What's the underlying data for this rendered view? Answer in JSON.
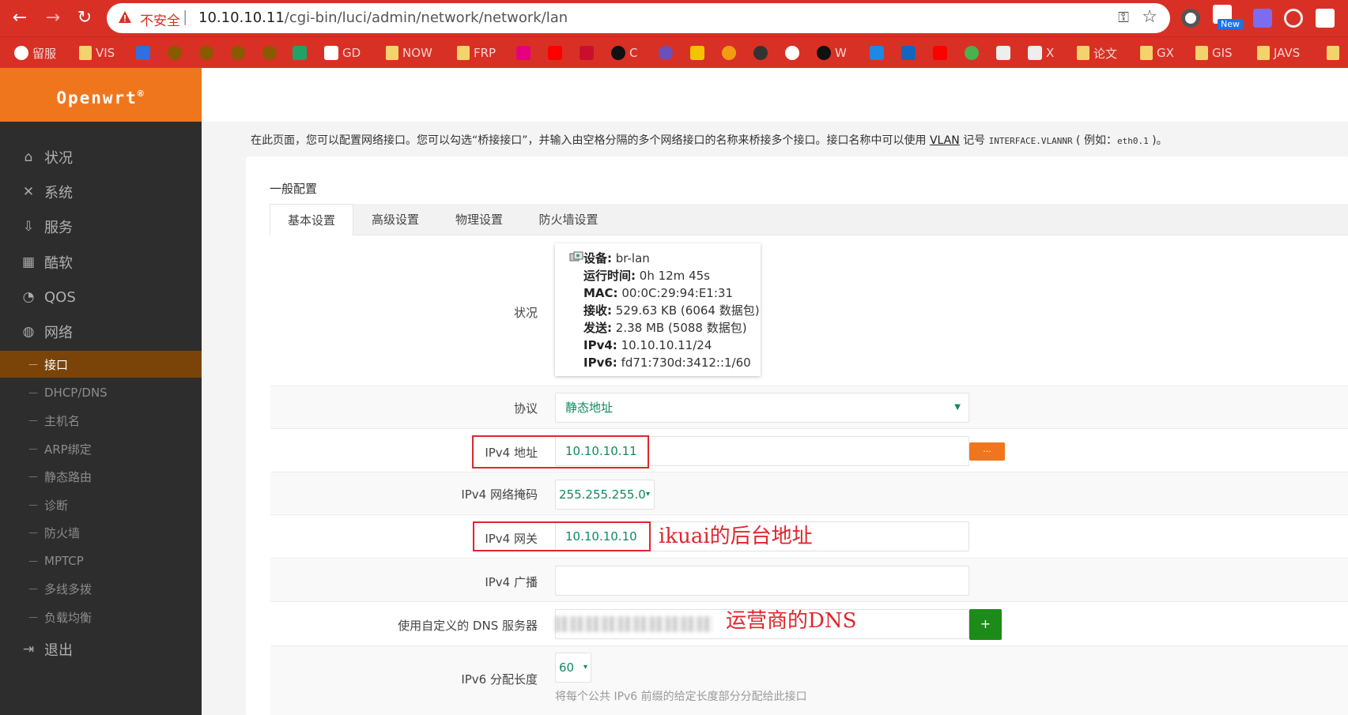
{
  "browser": {
    "insecure_label": "不安全",
    "url_host": "10.10.10.11",
    "url_path": "/cgi-bin/luci/admin/network/network/lan",
    "new_badge": "New",
    "bookmarks": [
      "留服",
      "VIS",
      "GD",
      "NOW",
      "FRP",
      "C",
      "W",
      "X",
      "论文",
      "GX",
      "GIS",
      "JAVS"
    ]
  },
  "brand": {
    "name": "Openwrt",
    "mark": "®"
  },
  "sidebar": {
    "menu": [
      {
        "label": "状况",
        "icon": "home-icon"
      },
      {
        "label": "系统",
        "icon": "wrench-icon"
      },
      {
        "label": "服务",
        "icon": "download-icon"
      },
      {
        "label": "酷软",
        "icon": "calendar-icon"
      },
      {
        "label": "QOS",
        "icon": "gauge-icon"
      },
      {
        "label": "网络",
        "icon": "globe-icon"
      }
    ],
    "network_sub": [
      "接口",
      "DHCP/DNS",
      "主机名",
      "ARP绑定",
      "静态路由",
      "诊断",
      "防火墙",
      "MPTCP",
      "多线多拨",
      "负载均衡"
    ],
    "active_sub": "接口",
    "logout": "退出"
  },
  "page": {
    "desc_prefix": "在此页面，您可以配置网络接口。您可以勾选“桥接接口”，并输入由空格分隔的多个网络接口的名称来桥接多个接口。接口名称中可以使用",
    "desc_link": "VLAN",
    "desc_mid": "记号",
    "desc_code1": "INTERFACE.VLANNR",
    "desc_mid2": "( 例如：",
    "desc_code2": "eth0.1",
    "desc_suffix": ")。",
    "section_title": "一般配置",
    "tabs": [
      "基本设置",
      "高级设置",
      "物理设置",
      "防火墙设置"
    ]
  },
  "form": {
    "status": {
      "label": "状况",
      "device_label": "设备:",
      "device": "br-lan",
      "uptime_label": "运行时间:",
      "uptime": "0h 12m 45s",
      "mac_label": "MAC:",
      "mac": "00:0C:29:94:E1:31",
      "rx_label": "接收:",
      "rx": "529.63 KB (6064 数据包)",
      "tx_label": "发送:",
      "tx": "2.38 MB (5088 数据包)",
      "ipv4_label": "IPv4:",
      "ipv4": "10.10.10.11/24",
      "ipv6_label": "IPv6:",
      "ipv6": "fd71:730d:3412::1/60"
    },
    "protocol": {
      "label": "协议",
      "value": "静态地址"
    },
    "ipv4_addr": {
      "label": "IPv4 地址",
      "value": "10.10.10.11",
      "button": "..."
    },
    "netmask": {
      "label": "IPv4 网络掩码",
      "value": "255.255.255.0"
    },
    "gateway": {
      "label": "IPv4 网关",
      "value": "10.10.10.10"
    },
    "broadcast": {
      "label": "IPv4 广播",
      "value": ""
    },
    "dns": {
      "label": "使用自定义的 DNS 服务器",
      "button": "+"
    },
    "ipv6_len": {
      "label": "IPv6 分配长度",
      "value": "60",
      "hint": "将每个公共 IPv6 前缀的给定长度部分分配给此接口"
    }
  },
  "annotations": {
    "gateway_note": "ikuai的后台地址",
    "dns_note": "运营商的DNS"
  },
  "colors": {
    "brand_orange": "#f0761e",
    "chrome_red": "#d93025",
    "sidebar_bg": "#2d2d2d",
    "active_sub": "#7a4409",
    "value_green": "#0d8a63",
    "annot_red": "#e0262d"
  }
}
